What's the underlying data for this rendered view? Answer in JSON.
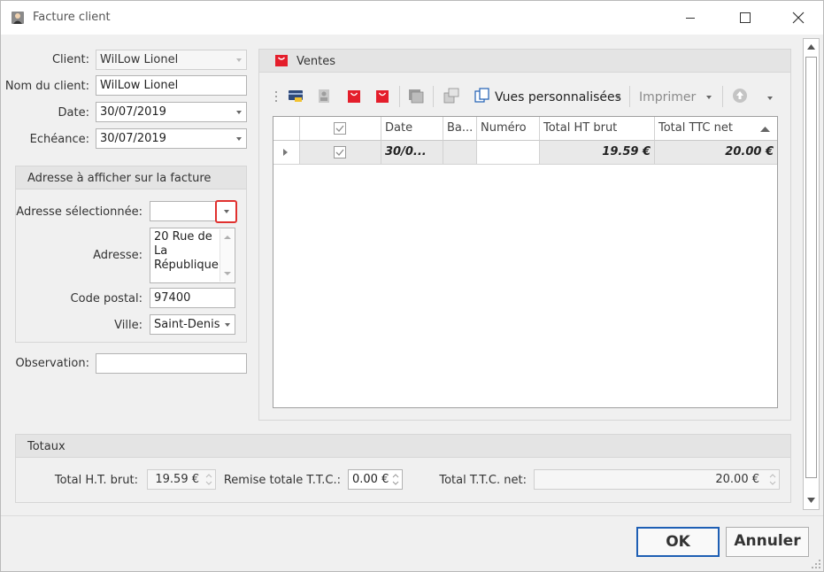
{
  "window": {
    "title": "Facture client"
  },
  "form": {
    "client_label": "Client:",
    "client_value": "WilLow Lionel",
    "nom_label": "Nom du client:",
    "nom_value": "WilLow Lionel",
    "date_label": "Date:",
    "date_value": "30/07/2019",
    "echeance_label": "Echéance:",
    "echeance_value": "30/07/2019",
    "observation_label": "Observation:",
    "observation_value": ""
  },
  "address": {
    "group_title": "Adresse à afficher sur la facture",
    "selected_label": "Adresse sélectionnée:",
    "selected_value": "",
    "adresse_label": "Adresse:",
    "adresse_line1": "20 Rue de",
    "adresse_line2": "La",
    "adresse_line3": "République",
    "cp_label": "Code postal:",
    "cp_value": "97400",
    "ville_label": "Ville:",
    "ville_value": "Saint-Denis"
  },
  "ventes": {
    "panel_title": "Ventes",
    "toolbar": {
      "vues_label": "Vues personnalisées",
      "imprimer_label": "Imprimer"
    },
    "columns": [
      "Date",
      "Ba...",
      "Numéro",
      "Total HT brut",
      "Total TTC net"
    ],
    "rows": [
      {
        "checked": true,
        "date": "30/0...",
        "ba": "",
        "numero": "",
        "total_ht": "19.59 €",
        "total_ttc": "20.00 €"
      }
    ]
  },
  "totaux": {
    "group_title": "Totaux",
    "ht_label": "Total H.T. brut:",
    "ht_value": "19.59 €",
    "remise_label": "Remise totale T.T.C.:",
    "remise_value": "0.00 €",
    "ttc_label": "Total T.T.C. net:",
    "ttc_value": "20.00 €"
  },
  "buttons": {
    "ok": "OK",
    "annuler": "Annuler"
  },
  "colors": {
    "highlight": "#e0312f",
    "accent": "#1e5fb4",
    "bag_red": "#e41e2b"
  }
}
